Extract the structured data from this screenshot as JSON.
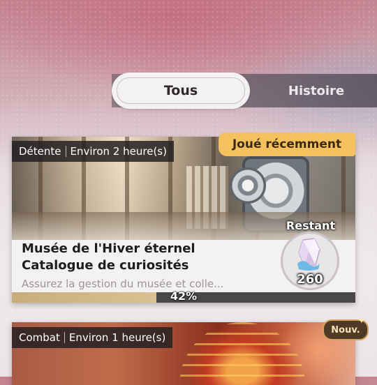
{
  "tabs": {
    "active": "Tous",
    "other": "Histoire"
  },
  "cards": [
    {
      "category": "Détente",
      "duration": "Environ 2 heure(s)",
      "badge": "Joué récemment",
      "title_line1": "Musée de l'Hiver éternel",
      "title_line2": "Catalogue de curiosités",
      "description": "Assurez la gestion du musée et colle...",
      "progress_label": "42%",
      "progress": 0.42,
      "remaining_label": "Restant",
      "remaining_value": "260",
      "icon": "crystal-icon"
    },
    {
      "category": "Combat",
      "duration": "Environ 1 heure(s)",
      "badge": "Nouv."
    }
  ],
  "colors": {
    "badge_recent": "#f5c05e",
    "progress_fill": "#c8ad79",
    "new_badge_border": "#d6a25a"
  }
}
